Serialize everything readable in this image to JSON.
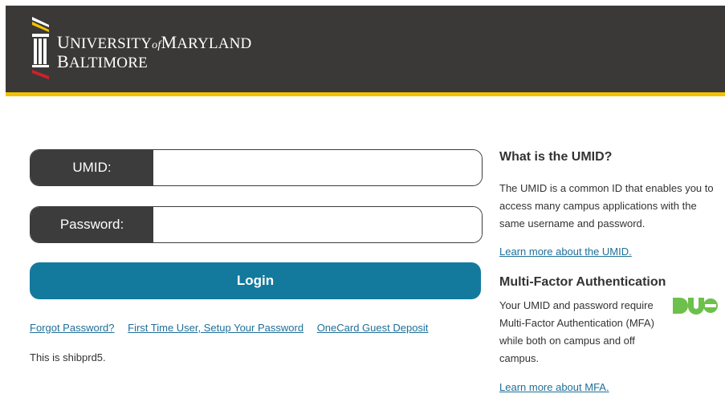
{
  "header": {
    "logo_line1_prefix": "U",
    "logo_line1_main": "NIVERSITY",
    "logo_line1_of": "of",
    "logo_line1_suffix_big": "M",
    "logo_line1_suffix": "ARYLAND",
    "logo_line2_big": "B",
    "logo_line2": "ALTIMORE",
    "colors": {
      "background": "#3a3938",
      "stripe": "#f2c200"
    }
  },
  "form": {
    "umid_label": "UMID:",
    "umid_value": "",
    "password_label": "Password:",
    "password_value": "",
    "login_label": "Login",
    "login_color": "#137a9e"
  },
  "links": {
    "forgot_password": "Forgot Password?",
    "first_time_user": "First Time User, Setup Your Password",
    "onecard_deposit": "OneCard Guest Deposit"
  },
  "server_note": "This is shibprd5.",
  "sidebar": {
    "umid_title": "What is the UMID?",
    "umid_description": "The UMID is a common ID that enables you to access many campus applications with the same username and password.",
    "umid_link": "Learn more about the UMID.",
    "mfa_title": "Multi-Factor Authentication",
    "mfa_description": "Your UMID and password require Multi-Factor Authentication (MFA) while both on campus and off campus.",
    "mfa_link": "Learn more about MFA.",
    "duo_logo_text": "DUO",
    "duo_color": "#6dc04b"
  },
  "icons": {
    "logo_mark": "university-column-logo-icon",
    "duo": "duo-logo-icon"
  }
}
